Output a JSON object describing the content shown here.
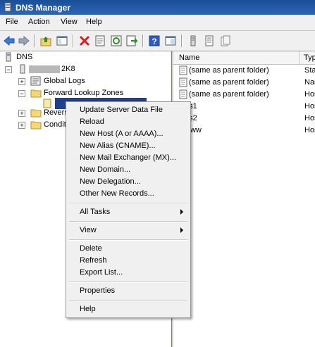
{
  "window": {
    "title": "DNS Manager"
  },
  "menubar": {
    "items": [
      "File",
      "Action",
      "View",
      "Help"
    ]
  },
  "toolbar": {
    "buttons": [
      "back-icon",
      "forward-icon",
      "up-folder-icon",
      "show-tree-icon",
      "delete-icon",
      "properties-icon",
      "refresh-icon",
      "export-icon",
      "help-icon",
      "console-icon",
      "server-icon",
      "list-icon",
      "records-icon"
    ]
  },
  "tree": {
    "root": "DNS",
    "server": "2K8",
    "global_logs": "Global Logs",
    "forward_zones": "Forward Lookup Zones",
    "reverse_zones": "Revers",
    "conditional": "Condit"
  },
  "list": {
    "columns": {
      "name": "Name",
      "type": "Typ"
    },
    "rows": [
      {
        "name": "(same as parent folder)",
        "type": "Sta"
      },
      {
        "name": "(same as parent folder)",
        "type": "Nar"
      },
      {
        "name": "(same as parent folder)",
        "type": "Hos"
      },
      {
        "name": "ns1",
        "type": "Hos"
      },
      {
        "name": "ns2",
        "type": "Hos"
      },
      {
        "name": "www",
        "type": "Hos"
      }
    ]
  },
  "context_menu": {
    "update_server": "Update Server Data File",
    "reload": "Reload",
    "new_host": "New Host (A or AAAA)...",
    "new_alias": "New Alias (CNAME)...",
    "new_mx": "New Mail Exchanger (MX)...",
    "new_domain": "New Domain...",
    "new_delegation": "New Delegation...",
    "other_records": "Other New Records...",
    "all_tasks": "All Tasks",
    "view": "View",
    "delete": "Delete",
    "refresh": "Refresh",
    "export": "Export List...",
    "properties": "Properties",
    "help": "Help"
  },
  "colors": {
    "title_bar": "#1a4f96",
    "selection": "#1e3f8c",
    "menu_bg": "#f0f0f0",
    "delete_red": "#d02020"
  }
}
